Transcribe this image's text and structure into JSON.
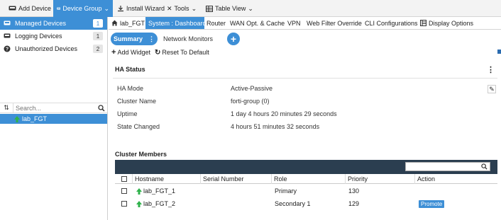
{
  "topbar": {
    "add_device": "Add Device",
    "device_group": "Device Group",
    "install_wizard": "Install Wizard",
    "tools": "Tools",
    "table_view": "Table View"
  },
  "sidebar": {
    "items": [
      {
        "label": "Managed Devices",
        "count": "1"
      },
      {
        "label": "Logging Devices",
        "count": "1"
      },
      {
        "label": "Unauthorized Devices",
        "count": "2"
      }
    ],
    "search_placeholder": "Search...",
    "tree_item": "lab_FGT"
  },
  "tabs": [
    "lab_FGT",
    "System : Dashboard",
    "Router",
    "WAN Opt. & Cache",
    "VPN",
    "Web Filter Override",
    "CLI Configurations",
    "Display Options"
  ],
  "subtabs": {
    "summary": "Summary",
    "network_monitors": "Network Monitors"
  },
  "actions": {
    "add_widget": "Add Widget",
    "reset": "Reset To Default"
  },
  "ha": {
    "title": "HA Status",
    "fields": [
      {
        "label": "HA Mode",
        "value": "Active-Passive"
      },
      {
        "label": "Cluster Name",
        "value": "forti-group (0)"
      },
      {
        "label": "Uptime",
        "value": "1 day 4 hours 20 minutes 29 seconds"
      },
      {
        "label": "State Changed",
        "value": "4 hours 51 minutes 32 seconds"
      }
    ]
  },
  "cluster": {
    "title": "Cluster Members",
    "columns": [
      "Hostname",
      "Serial Number",
      "Role",
      "Priority",
      "Action"
    ],
    "rows": [
      {
        "hostname": "lab_FGT_1",
        "serial": "",
        "role": "Primary",
        "priority": "130",
        "action": ""
      },
      {
        "hostname": "lab_FGT_2",
        "serial": "",
        "role": "Secondary 1",
        "priority": "129",
        "action": "Promote"
      }
    ]
  },
  "colors": {
    "accent": "#3d8fd6",
    "grid_header": "#2b3e50",
    "status_up": "#2fb24b"
  }
}
